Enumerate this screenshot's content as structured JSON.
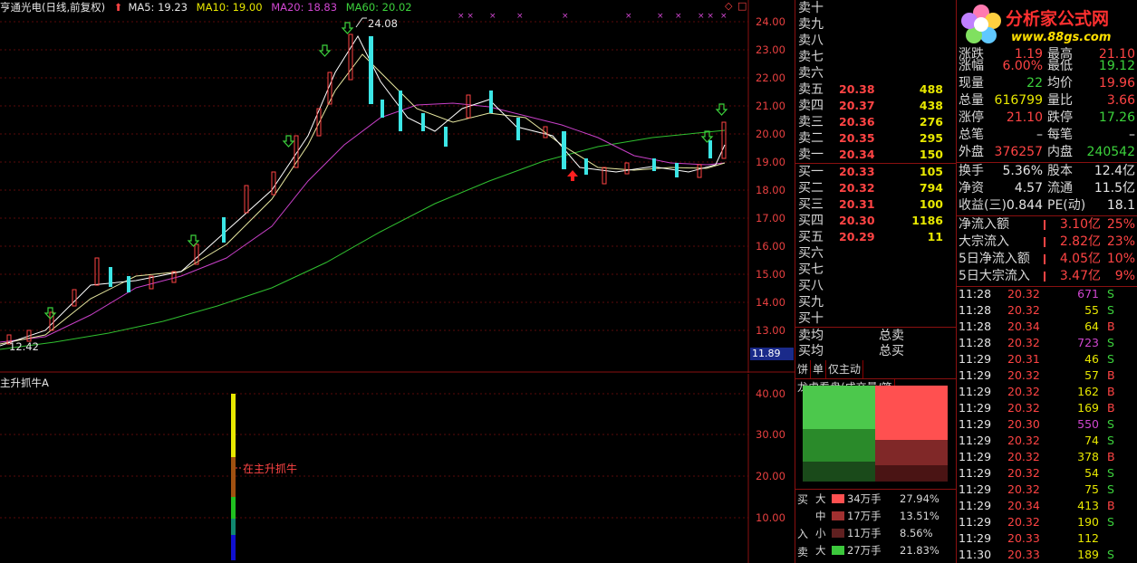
{
  "header": {
    "stock": "亨通光电(日线,前复权)",
    "ma5": "MA5: 19.23",
    "ma10": "MA10: 19.00",
    "ma20": "MA20: 18.83",
    "ma60": "MA60: 20.02",
    "diamond": "◇",
    "box": "□"
  },
  "price_axis": [
    "24.00",
    "23.00",
    "22.00",
    "21.00",
    "20.00",
    "19.00",
    "18.00",
    "17.00",
    "16.00",
    "15.00",
    "14.00",
    "13.00"
  ],
  "current_price_tag": "11.89",
  "high_label": "24.08",
  "low_label": "12.42",
  "indicator": {
    "title": "主升抓牛A",
    "axis": [
      "40.00",
      "30.00",
      "20.00",
      "10.00"
    ],
    "annotation": "在主升抓牛"
  },
  "orderbook": {
    "sell": [
      {
        "label": "卖十",
        "price": "",
        "vol": ""
      },
      {
        "label": "卖九",
        "price": "",
        "vol": ""
      },
      {
        "label": "卖八",
        "price": "",
        "vol": ""
      },
      {
        "label": "卖七",
        "price": "",
        "vol": ""
      },
      {
        "label": "卖六",
        "price": "",
        "vol": ""
      },
      {
        "label": "卖五",
        "price": "20.38",
        "vol": "488"
      },
      {
        "label": "卖四",
        "price": "20.37",
        "vol": "438"
      },
      {
        "label": "卖三",
        "price": "20.36",
        "vol": "276"
      },
      {
        "label": "卖二",
        "price": "20.35",
        "vol": "295"
      },
      {
        "label": "卖一",
        "price": "20.34",
        "vol": "150"
      }
    ],
    "buy": [
      {
        "label": "买一",
        "price": "20.33",
        "vol": "105"
      },
      {
        "label": "买二",
        "price": "20.32",
        "vol": "794"
      },
      {
        "label": "买三",
        "price": "20.31",
        "vol": "100"
      },
      {
        "label": "买四",
        "price": "20.30",
        "vol": "1186"
      },
      {
        "label": "买五",
        "price": "20.29",
        "vol": "11"
      },
      {
        "label": "买六",
        "price": "",
        "vol": ""
      },
      {
        "label": "买七",
        "price": "",
        "vol": ""
      },
      {
        "label": "买八",
        "price": "",
        "vol": ""
      },
      {
        "label": "买九",
        "price": "",
        "vol": ""
      },
      {
        "label": "买十",
        "price": "",
        "vol": ""
      }
    ],
    "sell_avg": "卖均",
    "buy_avg": "买均",
    "total_sell": "总卖",
    "total_buy": "总买"
  },
  "tabs": [
    "饼",
    "单",
    "仅主动",
    "龙虎看盘(成交量/笔"
  ],
  "flow": {
    "buy_label": "买",
    "in_label": "入",
    "sell_label": "卖",
    "rows": [
      {
        "size": "大",
        "amount": "34万手",
        "pct": "27.94%",
        "color": "#ff5050"
      },
      {
        "size": "中",
        "amount": "17万手",
        "pct": "13.51%",
        "color": "#a03030"
      },
      {
        "size": "小",
        "amount": "11万手",
        "pct": "8.56%",
        "color": "#602020"
      },
      {
        "size": "大",
        "amount": "27万手",
        "pct": "21.83%",
        "color": "#3cc83c"
      }
    ]
  },
  "logo": {
    "title": "分析家公式网",
    "url": "www.88gs.com"
  },
  "quote": {
    "rows": [
      {
        "l1": "涨跌",
        "v1": "1.19",
        "l2": "最高",
        "v2": "21.10",
        "c1": "#ff4444",
        "c2": "#ff4444"
      },
      {
        "l1": "涨幅",
        "v1": "6.00%",
        "l2": "最低",
        "v2": "19.12",
        "c1": "#ff4444",
        "c2": "#3cd23c"
      },
      {
        "l1": "现量",
        "v1": "22",
        "l2": "均价",
        "v2": "19.96",
        "c1": "#3cd23c",
        "c2": "#ff4444"
      },
      {
        "l1": "总量",
        "v1": "616799",
        "l2": "量比",
        "v2": "3.66",
        "c1": "#e8e800",
        "c2": "#ff4444"
      },
      {
        "l1": "涨停",
        "v1": "21.10",
        "l2": "跌停",
        "v2": "17.26",
        "c1": "#ff4444",
        "c2": "#3cd23c"
      },
      {
        "l1": "总笔",
        "v1": "–",
        "l2": "每笔",
        "v2": "–",
        "c1": "#e6e6e6",
        "c2": "#e6e6e6"
      },
      {
        "l1": "外盘",
        "v1": "376257",
        "l2": "内盘",
        "v2": "240542",
        "c1": "#ff4444",
        "c2": "#3cd23c"
      }
    ],
    "rows2": [
      {
        "l1": "换手",
        "v1": "5.36%",
        "l2": "股本",
        "v2": "12.4亿"
      },
      {
        "l1": "净资",
        "v1": "4.57",
        "l2": "流通",
        "v2": "11.5亿"
      },
      {
        "l1": "收益(三)",
        "v1": "0.844",
        "l2": "PE(动)",
        "v2": "18.1"
      }
    ],
    "flows": [
      {
        "label": "净流入额",
        "value": "3.10亿",
        "pct": "25%"
      },
      {
        "label": "大宗流入",
        "value": "2.82亿",
        "pct": "23%"
      },
      {
        "label": "5日净流入额",
        "value": "4.05亿",
        "pct": "10%"
      },
      {
        "label": "5日大宗流入",
        "value": "3.47亿",
        "pct": "9%"
      }
    ]
  },
  "ticks": [
    {
      "t": "11:28",
      "p": "20.32",
      "v": "671",
      "d": "S",
      "vc": "#d046d0"
    },
    {
      "t": "11:28",
      "p": "20.32",
      "v": "55",
      "d": "S",
      "vc": "#e8e800"
    },
    {
      "t": "11:28",
      "p": "20.34",
      "v": "64",
      "d": "B",
      "vc": "#e8e800"
    },
    {
      "t": "11:28",
      "p": "20.32",
      "v": "723",
      "d": "S",
      "vc": "#d046d0"
    },
    {
      "t": "11:29",
      "p": "20.31",
      "v": "46",
      "d": "S",
      "vc": "#e8e800"
    },
    {
      "t": "11:29",
      "p": "20.32",
      "v": "57",
      "d": "B",
      "vc": "#e8e800"
    },
    {
      "t": "11:29",
      "p": "20.32",
      "v": "162",
      "d": "B",
      "vc": "#e8e800"
    },
    {
      "t": "11:29",
      "p": "20.32",
      "v": "169",
      "d": "B",
      "vc": "#e8e800"
    },
    {
      "t": "11:29",
      "p": "20.30",
      "v": "550",
      "d": "S",
      "vc": "#d046d0"
    },
    {
      "t": "11:29",
      "p": "20.32",
      "v": "74",
      "d": "S",
      "vc": "#e8e800"
    },
    {
      "t": "11:29",
      "p": "20.32",
      "v": "378",
      "d": "B",
      "vc": "#e8e800"
    },
    {
      "t": "11:29",
      "p": "20.32",
      "v": "54",
      "d": "S",
      "vc": "#e8e800"
    },
    {
      "t": "11:29",
      "p": "20.32",
      "v": "75",
      "d": "S",
      "vc": "#e8e800"
    },
    {
      "t": "11:29",
      "p": "20.34",
      "v": "413",
      "d": "B",
      "vc": "#e8e800"
    },
    {
      "t": "11:29",
      "p": "20.32",
      "v": "190",
      "d": "S",
      "vc": "#e8e800"
    },
    {
      "t": "11:29",
      "p": "20.33",
      "v": "112",
      "d": "",
      "vc": "#e8e800"
    },
    {
      "t": "11:30",
      "p": "20.33",
      "v": "189",
      "d": "S",
      "vc": "#e8e800"
    }
  ]
}
